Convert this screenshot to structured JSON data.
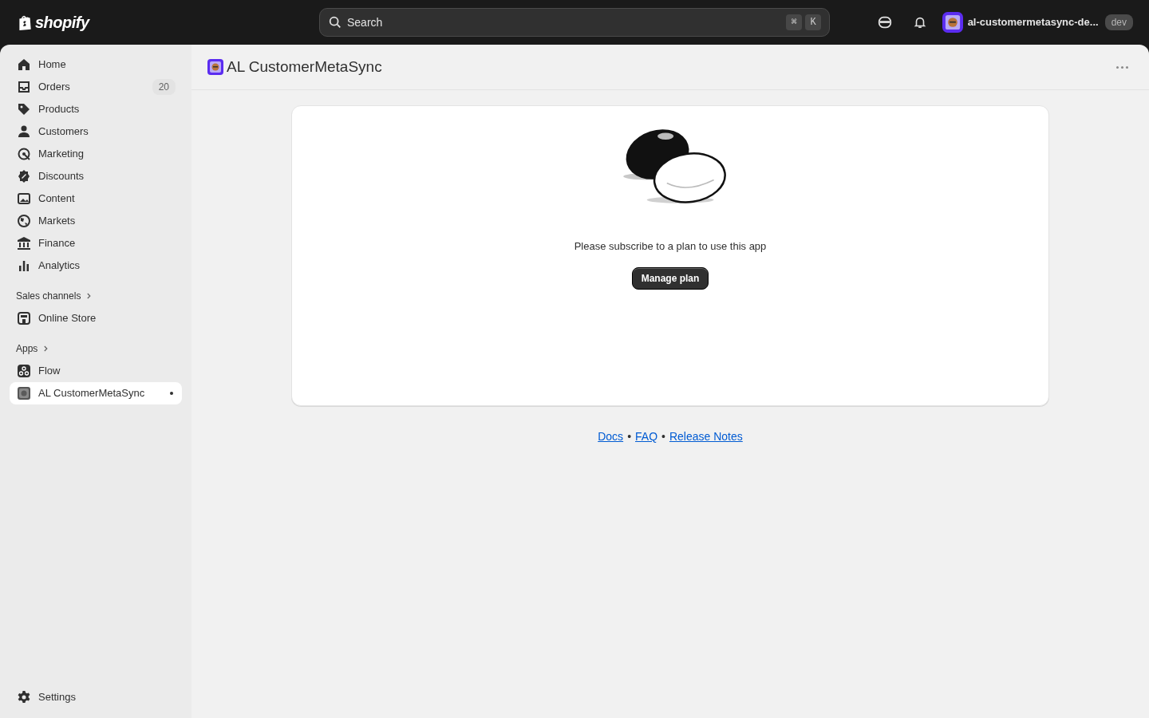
{
  "top_bar": {
    "logo": "shopify",
    "search": {
      "placeholder": "Search",
      "shortcut": [
        "⌘",
        "K"
      ]
    },
    "store": {
      "name": "al-customermetasync-de...",
      "badge": "dev"
    }
  },
  "sidebar": {
    "items": [
      {
        "label": "Home",
        "selected": false
      },
      {
        "label": "Orders",
        "selected": false,
        "count": "20"
      },
      {
        "label": "Products",
        "selected": false
      },
      {
        "label": "Customers",
        "selected": false
      },
      {
        "label": "Marketing",
        "selected": false
      },
      {
        "label": "Discounts",
        "selected": false
      },
      {
        "label": "Content",
        "selected": false
      },
      {
        "label": "Markets",
        "selected": false
      },
      {
        "label": "Finance",
        "selected": false
      },
      {
        "label": "Analytics",
        "selected": false
      }
    ],
    "sections": [
      {
        "title": "Sales channels",
        "items": [
          {
            "label": "Online Store",
            "selected": false
          }
        ]
      },
      {
        "title": "Apps",
        "items": [
          {
            "label": "Flow",
            "selected": false
          },
          {
            "label": "AL CustomerMetaSync",
            "selected": true
          }
        ]
      }
    ],
    "settings": "Settings"
  },
  "page": {
    "title": "AL CustomerMetaSync",
    "message": "Please subscribe to a plan to use this app",
    "button": "Manage plan",
    "footer": [
      {
        "kind": "link",
        "text": "Docs"
      },
      {
        "kind": "separator",
        "text": "•"
      },
      {
        "kind": "link",
        "text": "FAQ"
      },
      {
        "kind": "separator",
        "text": "•"
      },
      {
        "kind": "link",
        "text": "Release Notes"
      }
    ]
  }
}
